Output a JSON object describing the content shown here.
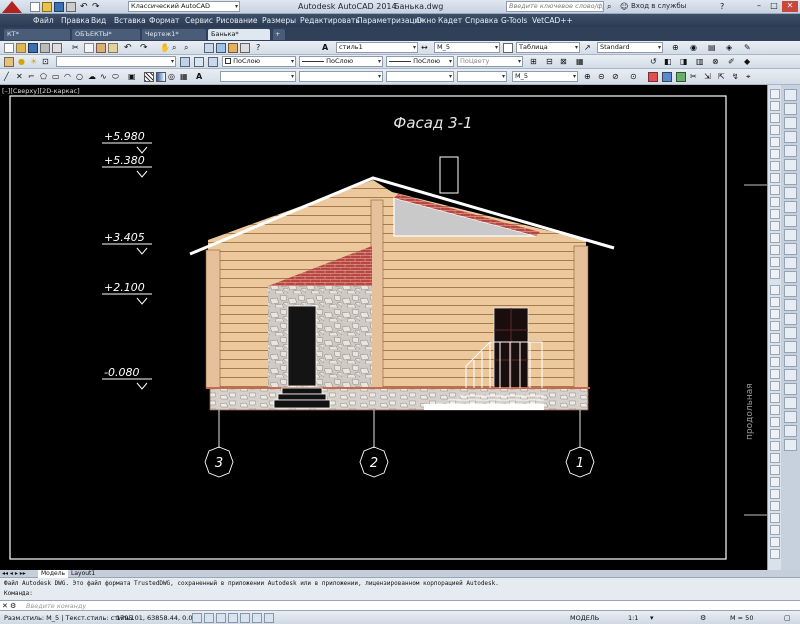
{
  "title": {
    "app": "Autodesk AutoCAD 2014",
    "file": "Банька.dwg",
    "workspace": "Классический AutoCAD",
    "search_placeholder": "Введите ключевое слово/фразу",
    "login": "Вход в службы"
  },
  "menu": [
    "Файл",
    "Правка",
    "Вид",
    "Вставка",
    "Формат",
    "Сервис",
    "Рисование",
    "Размеры",
    "Редактировать",
    "Параметризация",
    "Окно",
    "Кадет",
    "Справка",
    "G-Tools",
    "VetCAD++"
  ],
  "tabs": [
    "КТ*",
    "ОБЪЕКТЫ*",
    "Чертеж1*",
    "Банька*"
  ],
  "toolbar1": {
    "style": "стиль1",
    "dim": "M_5",
    "table": "Таблица",
    "mleader": "Standard"
  },
  "toolbar2": {
    "layer": "ПоСлою",
    "linetype": "ПоСлою",
    "lineweight": "ПоСлою",
    "color": "ПоЦвету"
  },
  "toolbar3": {
    "dimstyle": "M_5"
  },
  "viewport": {
    "label": "[–][Сверху][2D-каркас]"
  },
  "drawing": {
    "title": "Фасад 3-1",
    "levels": [
      "+5.980",
      "+5.380",
      "+3.405",
      "+2.100",
      "-0.080"
    ],
    "axes": [
      "3",
      "2",
      "1"
    ],
    "side_label": "продольная"
  },
  "layout_tabs": [
    "Модель",
    "Layout1"
  ],
  "command": {
    "history": "Файл Autodesk DWG. Это файл формата TrustedDWG, сохраненный в приложении Autodesk или в приложении, лицензированном корпорацией Autodesk.",
    "prompt": "Команда:",
    "placeholder": "Введите команду"
  },
  "status": {
    "text": "Разм.стиль: M_5 | Текст.стиль: стиль1",
    "coords": "1795.01, 63858.44, 0.00",
    "model": "МОДЕЛЬ",
    "scale": "1:1",
    "mscale": "M = 50"
  },
  "colors": {
    "log": "#e8c9a0",
    "log_line": "#a87a4c",
    "roof_red": "#b8473f",
    "stone": "#c9c4bd",
    "background": "#000000"
  }
}
